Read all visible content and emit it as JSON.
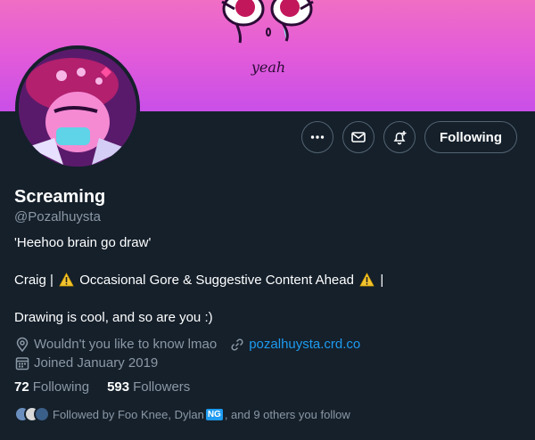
{
  "banner": {
    "caption": "yeah"
  },
  "actions": {
    "following_label": "Following"
  },
  "profile": {
    "display_name": "Screaming",
    "handle": "@Pozalhuysta",
    "bio": {
      "line1": "'Heehoo brain go draw'",
      "line2_prefix": "Craig |",
      "line2_middle": "Occasional Gore & Suggestive Content Ahead",
      "line2_suffix": "|",
      "line3": "Drawing is cool, and so are you :)"
    },
    "location": "Wouldn't you like to know lmao",
    "website": "pozalhuysta.crd.co",
    "joined": "Joined January 2019",
    "following_count": "72",
    "following_label": "Following",
    "followers_count": "593",
    "followers_label": "Followers",
    "followed_by": {
      "prefix": "Followed by Foo Knee, Dylan",
      "badge": "NG",
      "suffix": ", and 9 others you follow"
    }
  },
  "colors": {
    "background": "#15202b",
    "accent": "#1d9bf0",
    "muted": "#8b98a5",
    "banner": "#d95ad8"
  },
  "icons": [
    "more-icon",
    "mail-icon",
    "bell-plus-icon",
    "location-icon",
    "link-icon",
    "calendar-icon",
    "warning-icon"
  ]
}
